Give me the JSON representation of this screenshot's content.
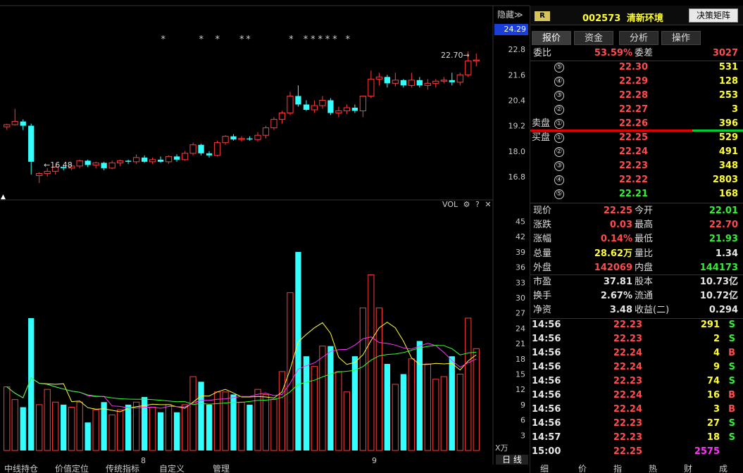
{
  "header": {
    "badge": "R",
    "code": "002573",
    "name": "清新环境",
    "decision_button": "决策矩阵",
    "hide_label": "隐藏≫",
    "current_price_box": "24.29"
  },
  "tabs": [
    "报价",
    "资金",
    "分析",
    "操作"
  ],
  "order_book": {
    "weibi_label": "委比",
    "weibi_value": "53.59%",
    "weicha_label": "委差",
    "weicha_value": "3027",
    "sell_label": "卖盘",
    "buy_label": "买盘",
    "sells": [
      {
        "level": "⑤",
        "price": "22.30",
        "vol": "531"
      },
      {
        "level": "④",
        "price": "22.29",
        "vol": "128"
      },
      {
        "level": "③",
        "price": "22.28",
        "vol": "253"
      },
      {
        "level": "②",
        "price": "22.27",
        "vol": "3"
      },
      {
        "level": "①",
        "price": "22.26",
        "vol": "396"
      }
    ],
    "buys": [
      {
        "level": "①",
        "price": "22.25",
        "vol": "529"
      },
      {
        "level": "②",
        "price": "22.24",
        "vol": "491"
      },
      {
        "level": "③",
        "price": "22.23",
        "vol": "348"
      },
      {
        "level": "④",
        "price": "22.22",
        "vol": "2803"
      },
      {
        "level": "⑤",
        "price": "22.21",
        "vol": "168"
      }
    ]
  },
  "quote": [
    {
      "l1": "现价",
      "v1": "22.25",
      "c1": "red",
      "l2": "今开",
      "v2": "22.01",
      "c2": "green"
    },
    {
      "l1": "涨跌",
      "v1": "0.03",
      "c1": "red",
      "l2": "最高",
      "v2": "22.70",
      "c2": "red"
    },
    {
      "l1": "涨幅",
      "v1": "0.14%",
      "c1": "red",
      "l2": "最低",
      "v2": "21.93",
      "c2": "green"
    },
    {
      "l1": "总量",
      "v1": "28.62万",
      "c1": "yellow",
      "l2": "量比",
      "v2": "1.34",
      "c2": "white"
    },
    {
      "l1": "外盘",
      "v1": "142069",
      "c1": "red",
      "l2": "内盘",
      "v2": "144173",
      "c2": "green"
    },
    {
      "l1": "市盈",
      "v1": "37.81",
      "c1": "white",
      "l2": "股本",
      "v2": "10.73亿",
      "c2": "white"
    },
    {
      "l1": "换手",
      "v1": "2.67%",
      "c1": "white",
      "l2": "流通",
      "v2": "10.72亿",
      "c2": "white"
    },
    {
      "l1": "净资",
      "v1": "3.48",
      "c1": "white",
      "l2": "收益(二)",
      "v2": "0.294",
      "c2": "white"
    }
  ],
  "trades": [
    {
      "time": "14:56",
      "price": "22.23",
      "pc": "red",
      "vol": "291",
      "vc": "yellow",
      "bs": "S",
      "bsc": "green"
    },
    {
      "time": "14:56",
      "price": "22.23",
      "pc": "red",
      "vol": "2",
      "vc": "yellow",
      "bs": "S",
      "bsc": "green"
    },
    {
      "time": "14:56",
      "price": "22.24",
      "pc": "red",
      "vol": "4",
      "vc": "yellow",
      "bs": "B",
      "bsc": "red"
    },
    {
      "time": "14:56",
      "price": "22.24",
      "pc": "red",
      "vol": "9",
      "vc": "yellow",
      "bs": "S",
      "bsc": "green"
    },
    {
      "time": "14:56",
      "price": "22.23",
      "pc": "red",
      "vol": "74",
      "vc": "yellow",
      "bs": "S",
      "bsc": "green"
    },
    {
      "time": "14:56",
      "price": "22.24",
      "pc": "red",
      "vol": "16",
      "vc": "yellow",
      "bs": "B",
      "bsc": "red"
    },
    {
      "time": "14:56",
      "price": "22.24",
      "pc": "red",
      "vol": "3",
      "vc": "yellow",
      "bs": "B",
      "bsc": "red"
    },
    {
      "time": "14:56",
      "price": "22.23",
      "pc": "red",
      "vol": "27",
      "vc": "yellow",
      "bs": "S",
      "bsc": "green"
    },
    {
      "time": "14:57",
      "price": "22.23",
      "pc": "red",
      "vol": "18",
      "vc": "yellow",
      "bs": "S",
      "bsc": "green"
    },
    {
      "time": "15:00",
      "price": "22.25",
      "pc": "red",
      "vol": "2575",
      "vc": "mag",
      "bs": "",
      "bsc": "red"
    }
  ],
  "chart_data": {
    "type": "candlestick+volume",
    "price_ticks": [
      "22.8",
      "21.6",
      "20.4",
      "19.2",
      "18.0",
      "16.8"
    ],
    "price_tick_values": [
      22.8,
      21.6,
      20.4,
      19.2,
      18.0,
      16.8
    ],
    "vol_ticks": [
      "45",
      "42",
      "39",
      "36",
      "33",
      "30",
      "27",
      "24",
      "21",
      "18",
      "15",
      "12",
      "9",
      "6",
      "3"
    ],
    "annotations": {
      "high": "22.70→",
      "low": "←16.48"
    },
    "x_labels": [
      "8",
      "9"
    ],
    "vol_header": "VOL",
    "vol_unit": "X万",
    "day_button": "日 线",
    "candles": [
      {
        "o": 19.15,
        "c": 19.25,
        "h": 19.3,
        "l": 19.0,
        "v": 12.5
      },
      {
        "o": 19.25,
        "c": 19.4,
        "h": 20.0,
        "l": 19.2,
        "v": 10.0
      },
      {
        "o": 19.4,
        "c": 19.2,
        "h": 19.5,
        "l": 19.0,
        "v": 8.5
      },
      {
        "o": 19.2,
        "c": 17.5,
        "h": 19.3,
        "l": 16.9,
        "v": 26.0
      },
      {
        "o": 16.85,
        "c": 16.95,
        "h": 17.0,
        "l": 16.5,
        "v": 9.0
      },
      {
        "o": 16.95,
        "c": 17.05,
        "h": 17.2,
        "l": 16.8,
        "v": 12.0
      },
      {
        "o": 17.05,
        "c": 17.25,
        "h": 17.3,
        "l": 16.9,
        "v": 9.5
      },
      {
        "o": 17.25,
        "c": 17.2,
        "h": 17.35,
        "l": 17.1,
        "v": 9.0
      },
      {
        "o": 17.2,
        "c": 17.3,
        "h": 17.4,
        "l": 17.1,
        "v": 8.5
      },
      {
        "o": 17.3,
        "c": 17.55,
        "h": 17.6,
        "l": 17.2,
        "v": 9.5
      },
      {
        "o": 17.55,
        "c": 17.35,
        "h": 17.6,
        "l": 17.25,
        "v": 5.5
      },
      {
        "o": 17.35,
        "c": 17.45,
        "h": 17.5,
        "l": 17.2,
        "v": 8.0
      },
      {
        "o": 17.45,
        "c": 17.2,
        "h": 17.5,
        "l": 17.1,
        "v": 9.5
      },
      {
        "o": 17.2,
        "c": 17.45,
        "h": 17.55,
        "l": 17.15,
        "v": 7.0
      },
      {
        "o": 17.45,
        "c": 17.55,
        "h": 17.6,
        "l": 17.3,
        "v": 8.0
      },
      {
        "o": 17.55,
        "c": 17.5,
        "h": 17.6,
        "l": 17.4,
        "v": 9.0
      },
      {
        "o": 17.5,
        "c": 17.7,
        "h": 17.85,
        "l": 17.4,
        "v": 9.5
      },
      {
        "o": 17.7,
        "c": 17.5,
        "h": 17.8,
        "l": 17.45,
        "v": 10.5
      },
      {
        "o": 17.5,
        "c": 17.6,
        "h": 17.7,
        "l": 17.4,
        "v": 8.5
      },
      {
        "o": 17.6,
        "c": 17.5,
        "h": 17.75,
        "l": 17.45,
        "v": 7.5
      },
      {
        "o": 17.5,
        "c": 17.75,
        "h": 17.8,
        "l": 17.4,
        "v": 9.0
      },
      {
        "o": 17.75,
        "c": 17.6,
        "h": 17.85,
        "l": 17.5,
        "v": 7.5
      },
      {
        "o": 17.6,
        "c": 17.9,
        "h": 18.0,
        "l": 17.55,
        "v": 9.0
      },
      {
        "o": 17.9,
        "c": 18.3,
        "h": 18.4,
        "l": 17.8,
        "v": 14.5
      },
      {
        "o": 18.3,
        "c": 17.9,
        "h": 18.35,
        "l": 17.8,
        "v": 13.5
      },
      {
        "o": 17.9,
        "c": 17.8,
        "h": 18.0,
        "l": 17.7,
        "v": 9.0
      },
      {
        "o": 17.8,
        "c": 18.4,
        "h": 18.5,
        "l": 17.75,
        "v": 11.5
      },
      {
        "o": 18.4,
        "c": 18.7,
        "h": 18.75,
        "l": 18.3,
        "v": 11.5
      },
      {
        "o": 18.7,
        "c": 18.55,
        "h": 18.8,
        "l": 18.5,
        "v": 11.0
      },
      {
        "o": 18.55,
        "c": 18.6,
        "h": 18.7,
        "l": 18.45,
        "v": 9.5
      },
      {
        "o": 18.6,
        "c": 18.55,
        "h": 18.7,
        "l": 18.5,
        "v": 9.0
      },
      {
        "o": 18.55,
        "c": 18.75,
        "h": 18.9,
        "l": 18.45,
        "v": 12.0
      },
      {
        "o": 18.75,
        "c": 19.1,
        "h": 19.2,
        "l": 18.6,
        "v": 11.0
      },
      {
        "o": 19.1,
        "c": 19.5,
        "h": 19.6,
        "l": 19.0,
        "v": 10.0
      },
      {
        "o": 19.5,
        "c": 19.8,
        "h": 19.9,
        "l": 19.3,
        "v": 15.5
      },
      {
        "o": 19.8,
        "c": 20.6,
        "h": 20.8,
        "l": 19.7,
        "v": 31.0
      },
      {
        "o": 20.6,
        "c": 20.2,
        "h": 21.1,
        "l": 20.1,
        "v": 39.0
      },
      {
        "o": 20.2,
        "c": 19.95,
        "h": 20.4,
        "l": 19.9,
        "v": 18.5
      },
      {
        "o": 19.95,
        "c": 20.15,
        "h": 20.4,
        "l": 19.8,
        "v": 16.5
      },
      {
        "o": 20.15,
        "c": 20.4,
        "h": 20.6,
        "l": 20.0,
        "v": 20.5
      },
      {
        "o": 20.4,
        "c": 19.8,
        "h": 20.5,
        "l": 19.7,
        "v": 20.5
      },
      {
        "o": 19.8,
        "c": 19.9,
        "h": 20.1,
        "l": 19.6,
        "v": 15.5
      },
      {
        "o": 19.9,
        "c": 20.05,
        "h": 20.2,
        "l": 19.75,
        "v": 11.5
      },
      {
        "o": 20.05,
        "c": 19.9,
        "h": 20.2,
        "l": 19.8,
        "v": 18.5
      },
      {
        "o": 19.9,
        "c": 20.6,
        "h": 20.6,
        "l": 19.6,
        "v": 28.0
      },
      {
        "o": 20.6,
        "c": 21.4,
        "h": 21.8,
        "l": 20.5,
        "v": 34.5
      },
      {
        "o": 21.4,
        "c": 21.5,
        "h": 21.7,
        "l": 21.1,
        "v": 28.0
      },
      {
        "o": 21.5,
        "c": 21.2,
        "h": 21.6,
        "l": 21.0,
        "v": 17.0
      },
      {
        "o": 21.2,
        "c": 21.35,
        "h": 21.7,
        "l": 21.05,
        "v": 13.0
      },
      {
        "o": 21.35,
        "c": 21.1,
        "h": 21.4,
        "l": 21.0,
        "v": 15.0
      },
      {
        "o": 21.1,
        "c": 21.35,
        "h": 21.7,
        "l": 21.0,
        "v": 18.0
      },
      {
        "o": 21.35,
        "c": 21.1,
        "h": 21.5,
        "l": 21.0,
        "v": 21.5
      },
      {
        "o": 21.1,
        "c": 21.2,
        "h": 21.4,
        "l": 20.9,
        "v": 17.0
      },
      {
        "o": 21.2,
        "c": 21.3,
        "h": 21.4,
        "l": 21.0,
        "v": 14.0
      },
      {
        "o": 21.3,
        "c": 21.35,
        "h": 21.5,
        "l": 21.2,
        "v": 14.5
      },
      {
        "o": 21.35,
        "c": 21.25,
        "h": 21.7,
        "l": 21.1,
        "v": 18.5
      },
      {
        "o": 21.25,
        "c": 21.6,
        "h": 21.7,
        "l": 21.1,
        "v": 15.0
      },
      {
        "o": 21.6,
        "c": 22.25,
        "h": 22.7,
        "l": 21.5,
        "v": 26.0
      },
      {
        "o": 22.25,
        "c": 22.3,
        "h": 22.6,
        "l": 22.0,
        "v": 20.0
      }
    ]
  }
}
